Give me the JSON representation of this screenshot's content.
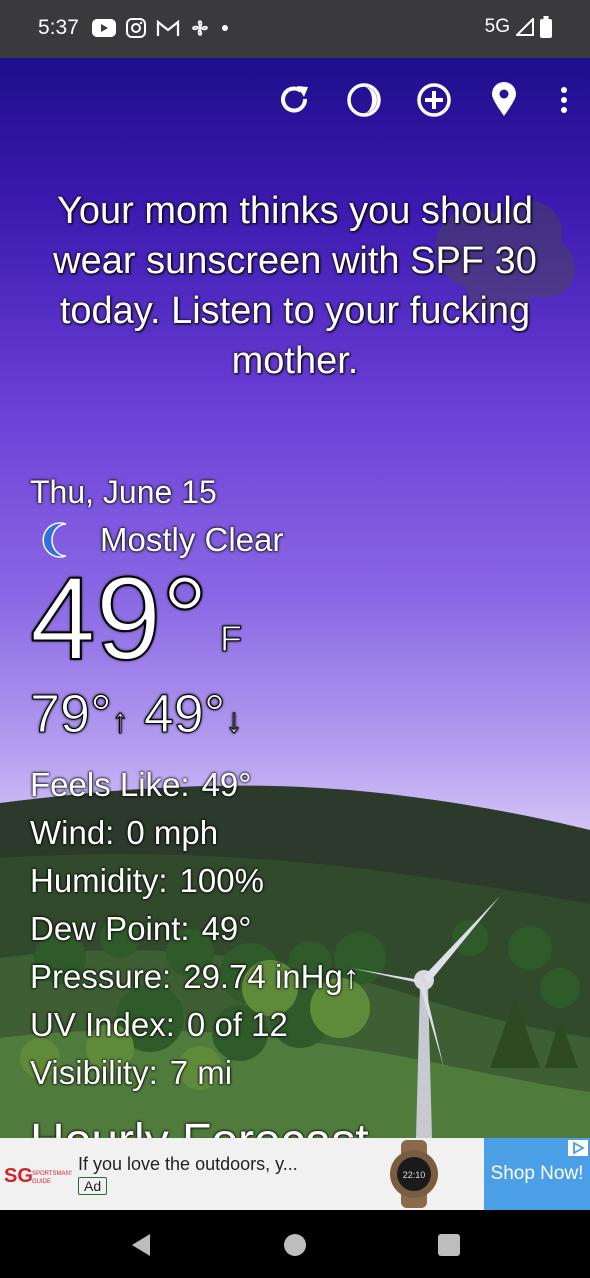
{
  "status_bar": {
    "time": "5:37",
    "network": "5G",
    "left_icons": [
      "youtube-icon",
      "instagram-icon",
      "gmail-icon",
      "fan-icon",
      "dot-icon"
    ],
    "right_icons": [
      "signal-icon",
      "battery-icon"
    ]
  },
  "toolbar": {
    "buttons": [
      "refresh-icon",
      "theme-icon",
      "add-location-icon",
      "location-pin-icon",
      "more-menu-icon"
    ]
  },
  "message": "Your mom thinks you should wear sunscreen with SPF 30 today. Listen to your fucking mother.",
  "weather": {
    "date": "Thu, June 15",
    "condition": "Mostly Clear",
    "condition_icon": "crescent-moon-icon",
    "temperature": "49°",
    "unit": "F",
    "high": "79°",
    "low": "49°",
    "high_arrow": "↑",
    "low_arrow": "↓"
  },
  "stats": [
    {
      "label": "Feels Like:",
      "value": "49°"
    },
    {
      "label": "Wind:",
      "value": "0 mph"
    },
    {
      "label": "Humidity:",
      "value": "100%"
    },
    {
      "label": "Dew Point:",
      "value": "49°"
    },
    {
      "label": "Pressure:",
      "value": "29.74 inHg↑"
    },
    {
      "label": "UV Index:",
      "value": "0 of 12"
    },
    {
      "label": "Visibility:",
      "value": "7 mi"
    }
  ],
  "section_heading": "Hourly Forecast",
  "ad": {
    "text": "If you love the outdoors, y...",
    "badge": "Ad",
    "cta": "Shop Now!",
    "advertiser_logo_text": "SPORTSMAN'S GUIDE",
    "watch_readout": "22:10"
  },
  "nav_bar": {
    "buttons": [
      "back-icon",
      "home-icon",
      "recents-icon"
    ]
  },
  "colors": {
    "status_bar_bg": "#3a3a3c",
    "sky_top": "#1e0e8c",
    "sky_bottom": "#d3c6f7",
    "ad_cta": "#4a9fe6"
  }
}
